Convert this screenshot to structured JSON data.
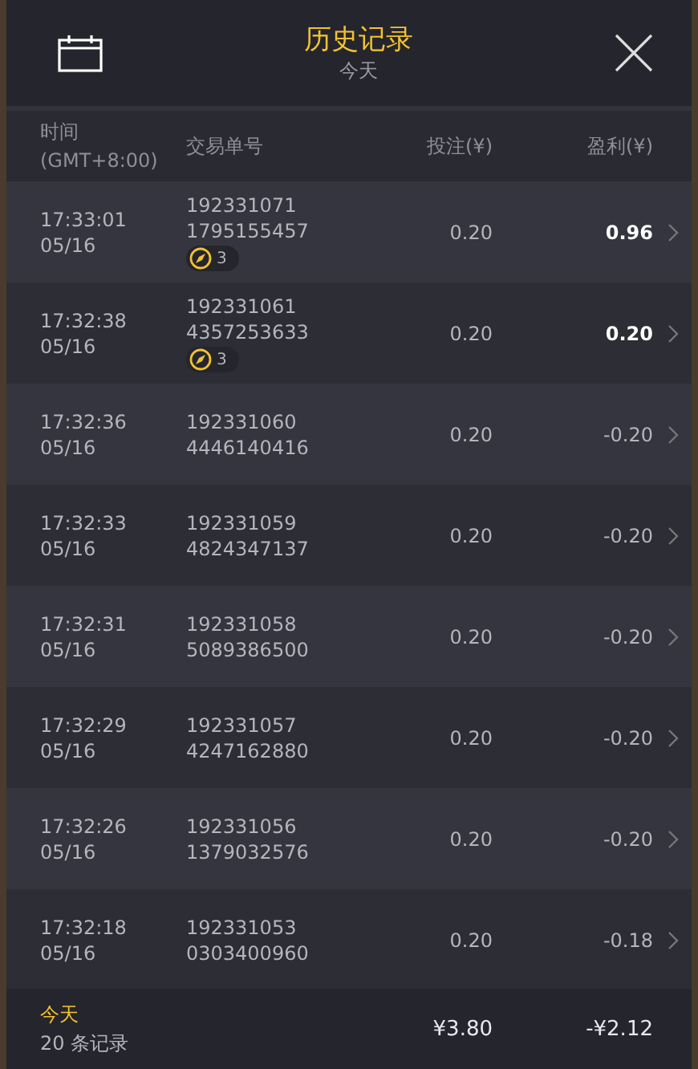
{
  "header": {
    "title": "历史记录",
    "subtitle": "今天"
  },
  "columns": [
    {
      "label": "时间",
      "sub": "(GMT+8:00)"
    },
    {
      "label": "交易单号"
    },
    {
      "label": "投注(¥)"
    },
    {
      "label": "盈利(¥)"
    }
  ],
  "rows": [
    {
      "time": "17:33:01",
      "date": "05/16",
      "order": "192331071",
      "order_2": "1795155457",
      "badge": "3",
      "stake": "0.20",
      "profit": "0.96",
      "won": true
    },
    {
      "time": "17:32:38",
      "date": "05/16",
      "order": "192331061",
      "order_2": "4357253633",
      "badge": "3",
      "stake": "0.20",
      "profit": "0.20",
      "won": true
    },
    {
      "time": "17:32:36",
      "date": "05/16",
      "order": "192331060",
      "order_2": "4446140416",
      "stake": "0.20",
      "profit": "-0.20",
      "won": false
    },
    {
      "time": "17:32:33",
      "date": "05/16",
      "order": "192331059",
      "order_2": "4824347137",
      "stake": "0.20",
      "profit": "-0.20",
      "won": false
    },
    {
      "time": "17:32:31",
      "date": "05/16",
      "order": "192331058",
      "order_2": "5089386500",
      "stake": "0.20",
      "profit": "-0.20",
      "won": false
    },
    {
      "time": "17:32:29",
      "date": "05/16",
      "order": "192331057",
      "order_2": "4247162880",
      "stake": "0.20",
      "profit": "-0.20",
      "won": false
    },
    {
      "time": "17:32:26",
      "date": "05/16",
      "order": "192331056",
      "order_2": "1379032576",
      "stake": "0.20",
      "profit": "-0.20",
      "won": false
    },
    {
      "time": "17:32:18",
      "date": "05/16",
      "order": "192331053",
      "order_2": "0303400960",
      "stake": "0.20",
      "profit": "-0.18",
      "won": false
    }
  ],
  "footer": {
    "period": "今天",
    "count": "20 条记录",
    "stake_total": "¥3.80",
    "profit_total": "-¥2.12"
  }
}
